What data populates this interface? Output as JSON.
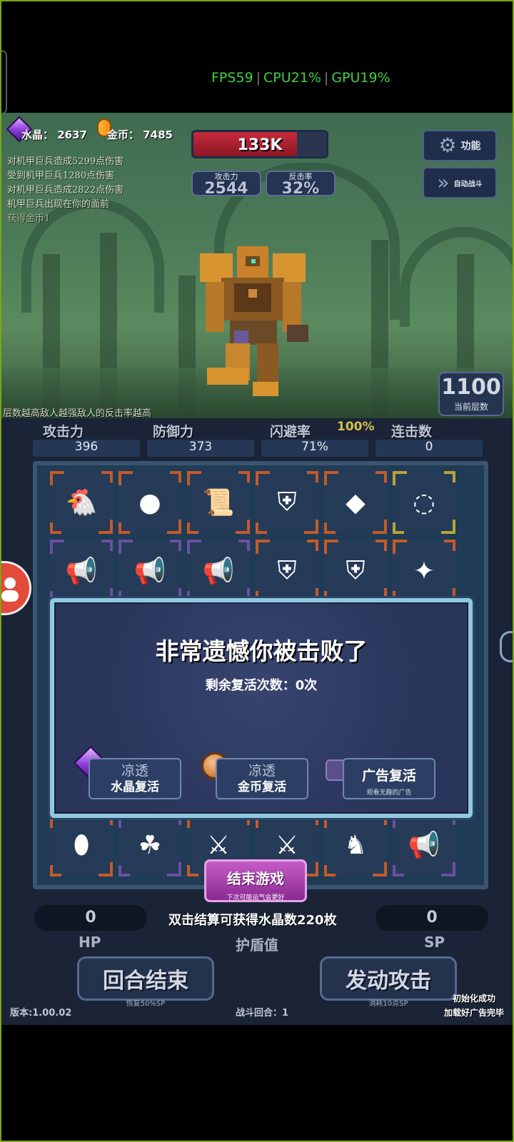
{
  "perf": {
    "fps": "FPS59",
    "cpu": "CPU21%",
    "gpu": "GPU19%"
  },
  "resources": {
    "crystal_label": "水晶：",
    "crystal_value": "2637",
    "gold_label": "金币：",
    "gold_value": "7485"
  },
  "enemy": {
    "hp_text": "133K",
    "hp_fraction": 0.78
  },
  "battle_stats": {
    "attack_label": "攻击力",
    "attack_value": "2544",
    "counter_label": "反击率",
    "counter_value": "32%"
  },
  "side_buttons": {
    "function_label": "功能",
    "auto_label": "自动战斗"
  },
  "battle_log": [
    "对机甲巨兵造成5299点伤害",
    "受到机甲巨兵1280点伤害",
    "对机甲巨兵造成2822点伤害",
    "机甲巨兵出现在你的面前",
    "获得金币1"
  ],
  "hint": "层数越高敌人越强敌人的反击率越高",
  "floor": {
    "value": "1100",
    "label": "当前层数"
  },
  "player_stats": {
    "attack": {
      "label": "攻击力",
      "value": "396"
    },
    "defense": {
      "label": "防御力",
      "value": "373"
    },
    "dodge": {
      "label": "闪避率",
      "value": "71%",
      "cap": "100%"
    },
    "combo": {
      "label": "连击数",
      "value": "0"
    }
  },
  "defeat_modal": {
    "title": "非常遗憾你被击败了",
    "revives": "剩余复活次数：0次",
    "crystal_btn": {
      "cooldown": "凉透",
      "label": "水晶复活"
    },
    "gold_btn": {
      "cooldown": "凉透",
      "label": "金币复活"
    },
    "ad_btn": {
      "label": "广告复活",
      "sub": "观看无趣的广告"
    }
  },
  "end_game": {
    "label": "结束游戏",
    "sub": "下次可能运气会更好"
  },
  "bottom": {
    "hp_value": "0",
    "sp_value": "0",
    "settle_text": "双击结算可获得水晶数220枚",
    "hp_label": "HP",
    "shield_label": "护盾值",
    "sp_label": "SP",
    "end_turn": {
      "label": "回合结束",
      "sub": "恢复50%SP"
    },
    "attack": {
      "label": "发动攻击",
      "sub": "消耗10点SP"
    },
    "version": "版本:1.00.02",
    "round": "战斗回合：1",
    "toast1": "初始化成功",
    "toast2": "加载好广告完毕"
  },
  "grid_icons": [
    [
      "chicken-icon",
      "ball-icon",
      "scroll-icon",
      "armor-icon",
      "rock-icon",
      "necklace-icon"
    ],
    [
      "megaphone-icon",
      "megaphone-icon",
      "megaphone-icon",
      "armor-icon",
      "armor-icon",
      "feather-icon"
    ],
    [
      "stone-icon",
      "clover-icon",
      "claw-icon",
      "claw-icon",
      "dragon-statue-icon",
      "megaphone-icon"
    ]
  ]
}
